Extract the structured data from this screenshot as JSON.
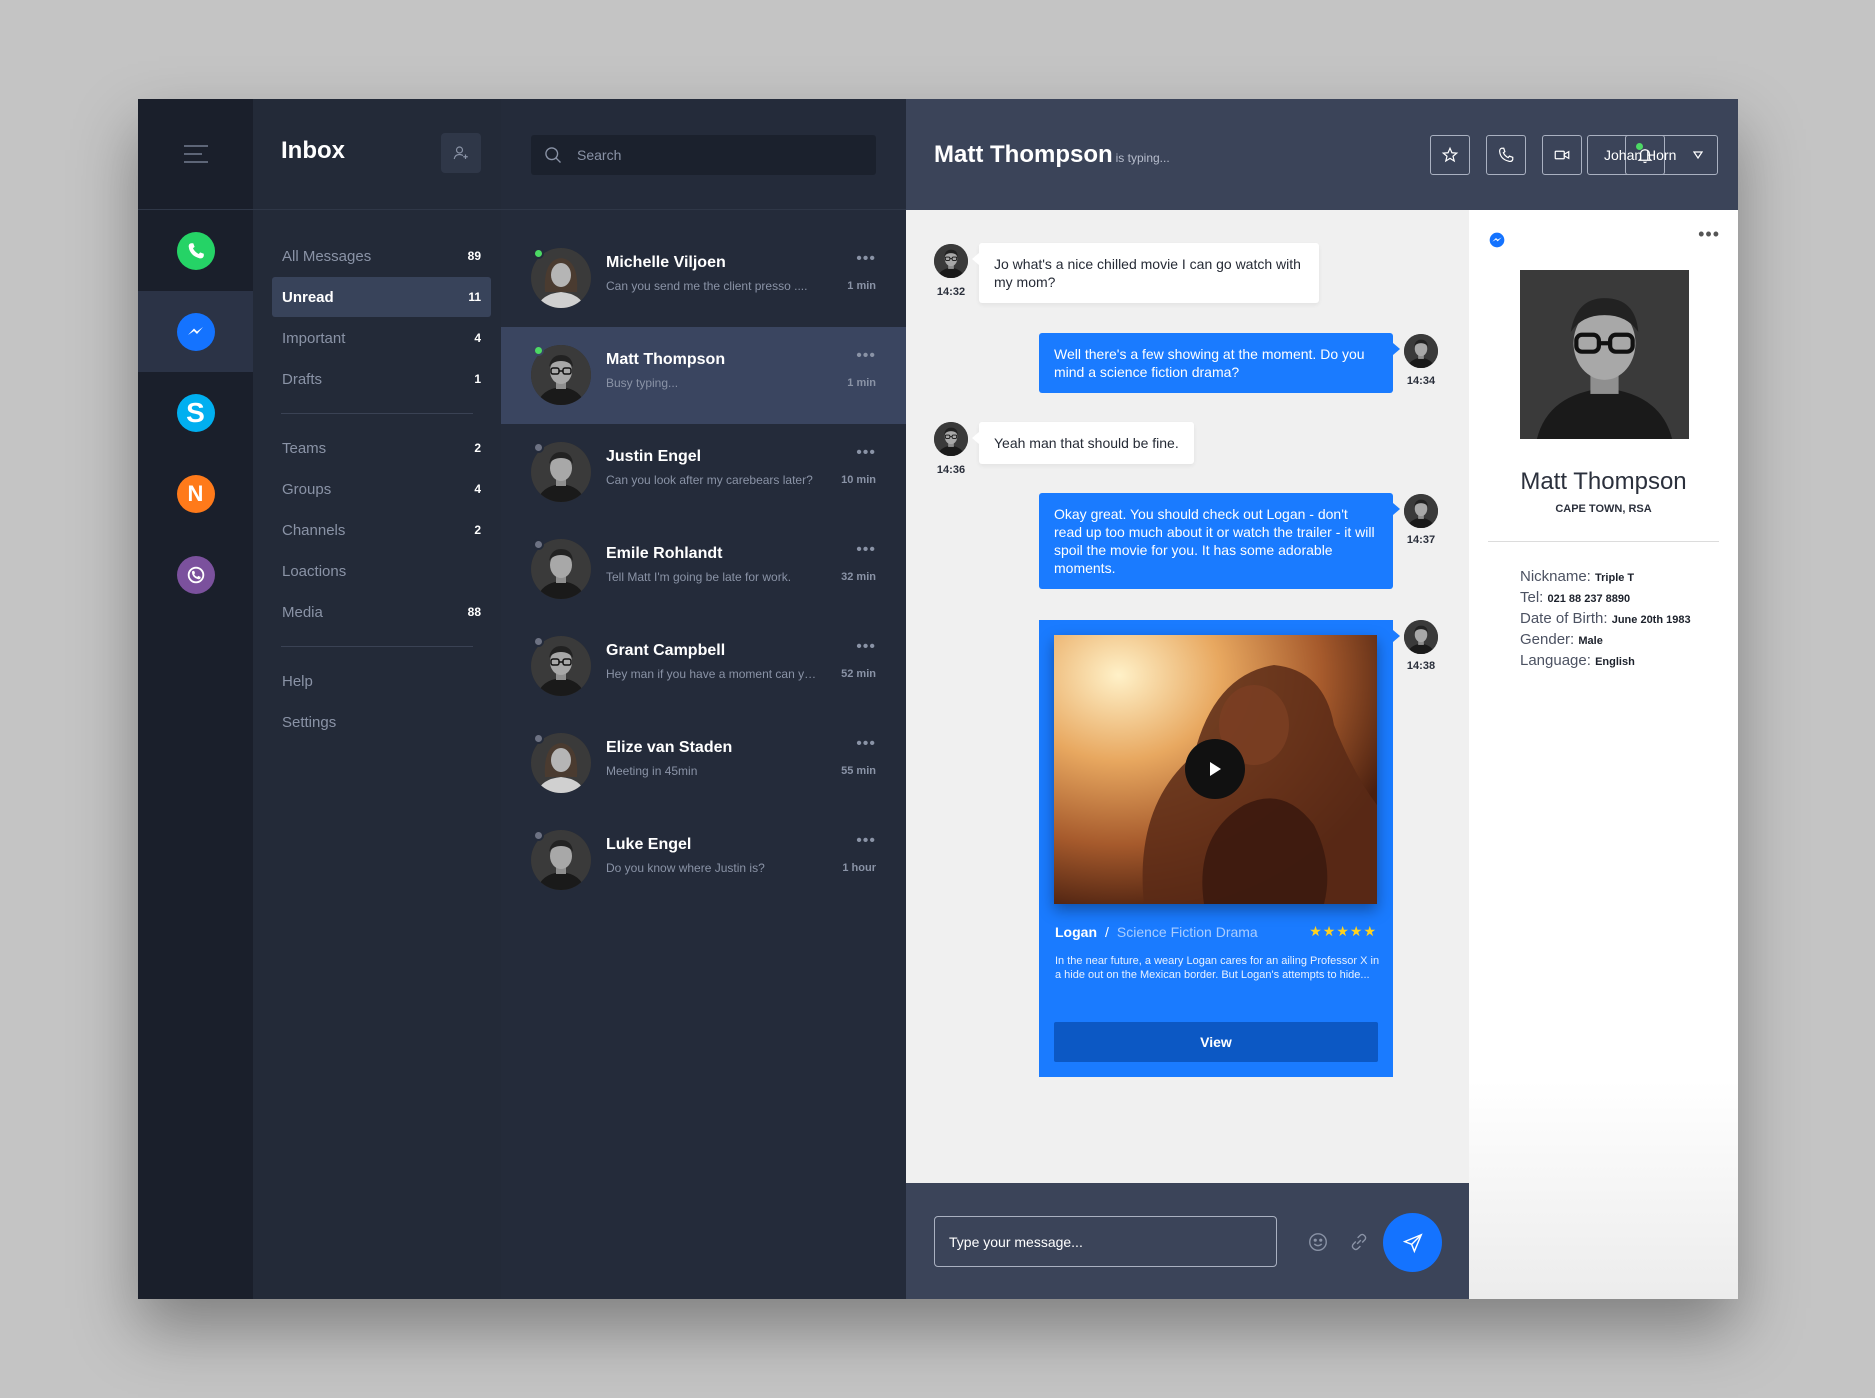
{
  "rail": {
    "apps": [
      {
        "name": "whatsapp",
        "color": "#25d366"
      },
      {
        "name": "messenger",
        "color": "#1473ff"
      },
      {
        "name": "skype",
        "color": "#00aff0",
        "letter": "S"
      },
      {
        "name": "n-app",
        "color": "#ff7a1a",
        "letter": "N"
      },
      {
        "name": "viber",
        "color": "#7b519d"
      }
    ]
  },
  "folders": {
    "title": "Inbox",
    "group1": [
      {
        "label": "All Messages",
        "count": "89"
      },
      {
        "label": "Unread",
        "count": "11"
      },
      {
        "label": "Important",
        "count": "4"
      },
      {
        "label": "Drafts",
        "count": "1"
      }
    ],
    "group2": [
      {
        "label": "Teams",
        "count": "2"
      },
      {
        "label": "Groups",
        "count": "4"
      },
      {
        "label": "Channels",
        "count": "2"
      },
      {
        "label": "Loactions",
        "count": ""
      },
      {
        "label": "Media",
        "count": "88"
      }
    ],
    "group3": [
      {
        "label": "Help"
      },
      {
        "label": "Settings"
      }
    ]
  },
  "search": {
    "placeholder": "Search"
  },
  "conversations": [
    {
      "name": "Michelle Viljoen",
      "preview": "Can you send me the client presso ....",
      "time": "1 min",
      "online": true
    },
    {
      "name": "Matt Thompson",
      "preview": "Busy typing...",
      "time": "1 min",
      "online": true
    },
    {
      "name": "Justin Engel",
      "preview": "Can you look after my carebears later?",
      "time": "10 min",
      "online": false
    },
    {
      "name": "Emile Rohlandt",
      "preview": "Tell Matt I'm going be late for work.",
      "time": "32 min",
      "online": false
    },
    {
      "name": "Grant Campbell",
      "preview": "Hey man if you have a moment can you ...",
      "time": "52 min",
      "online": false
    },
    {
      "name": "Elize van Staden",
      "preview": "Meeting in 45min",
      "time": "55 min",
      "online": false
    },
    {
      "name": "Luke Engel",
      "preview": "Do you know where Justin is?",
      "time": "1 hour",
      "online": false
    }
  ],
  "chat": {
    "name": "Matt Thompson",
    "status": "is typing...",
    "user": "Johan Horn",
    "messages": [
      {
        "text": "Jo what's a nice chilled movie I can go watch with my mom?",
        "time": "14:32"
      },
      {
        "text": "Well there's a few showing at the moment. Do you mind a science fiction drama?",
        "time": "14:34"
      },
      {
        "text": "Yeah man that should be fine.",
        "time": "14:36"
      },
      {
        "text": "Okay great. You should check out Logan - don't read up too much about it or watch the trailer - it will spoil the movie for you. It has some adorable moments.",
        "time": "14:37"
      },
      {
        "time": "14:38"
      }
    ],
    "movie": {
      "title": "Logan",
      "separator": "/",
      "genre": "Science Fiction Drama",
      "rating": 5,
      "stars": "★★★★★",
      "description": "In the near future, a weary Logan cares for an ailing Professor X in a hide out on the Mexican border. But Logan's attempts to hide...",
      "button": "View"
    },
    "input_placeholder": "Type your message..."
  },
  "profile": {
    "name": "Matt Thompson",
    "location": "CAPE TOWN, RSA",
    "details": [
      {
        "label": "Nickname:",
        "value": "Triple T"
      },
      {
        "label": "Tel:",
        "value": "021 88 237 8890"
      },
      {
        "label": "Date of Birth:",
        "value": "June 20th 1983"
      },
      {
        "label": "Gender:",
        "value": "Male"
      },
      {
        "label": "Language:",
        "value": "English"
      }
    ]
  },
  "colors": {
    "accent": "#1a7bff",
    "online": "#4cd964",
    "star": "#ffd21f"
  }
}
